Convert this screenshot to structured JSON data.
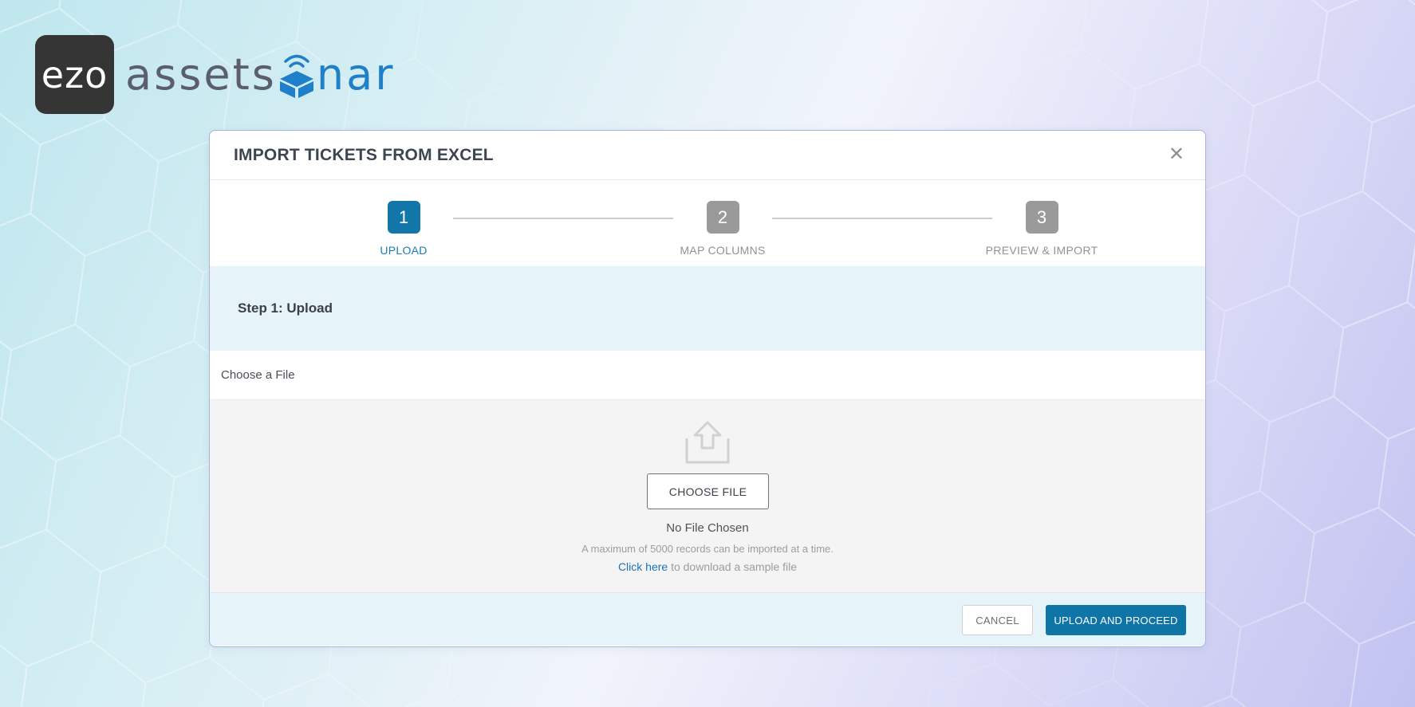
{
  "brand": {
    "logo_box_text": "ezo",
    "wordmark_part1": "assets",
    "wordmark_part2": "nar",
    "logo_icon": "sonar-box-icon",
    "colors": {
      "wordmark_gray": "#5b5e6c",
      "wordmark_blue": "#1f7fc9",
      "logo_box": "#353536"
    }
  },
  "modal": {
    "title": "IMPORT TICKETS FROM EXCEL",
    "close_icon": "close-icon",
    "steps": [
      {
        "number": "1",
        "label": "UPLOAD",
        "active": true
      },
      {
        "number": "2",
        "label": "MAP COLUMNS",
        "active": false
      },
      {
        "number": "3",
        "label": "PREVIEW & IMPORT",
        "active": false
      }
    ],
    "step_title": "Step 1: Upload",
    "choose_label": "Choose a File",
    "upload": {
      "icon": "upload-icon",
      "button_label": "CHOOSE FILE",
      "status": "No File Chosen",
      "max_note": "A maximum of 5000 records can be imported at a time.",
      "sample_link": "Click here",
      "sample_rest": " to download a sample file"
    },
    "footer": {
      "cancel_label": "CANCEL",
      "proceed_label": "UPLOAD AND PROCEED"
    },
    "colors": {
      "accent": "#0f74a6",
      "band": "#e6f4f9",
      "step_inactive": "#9a9a9a"
    }
  }
}
